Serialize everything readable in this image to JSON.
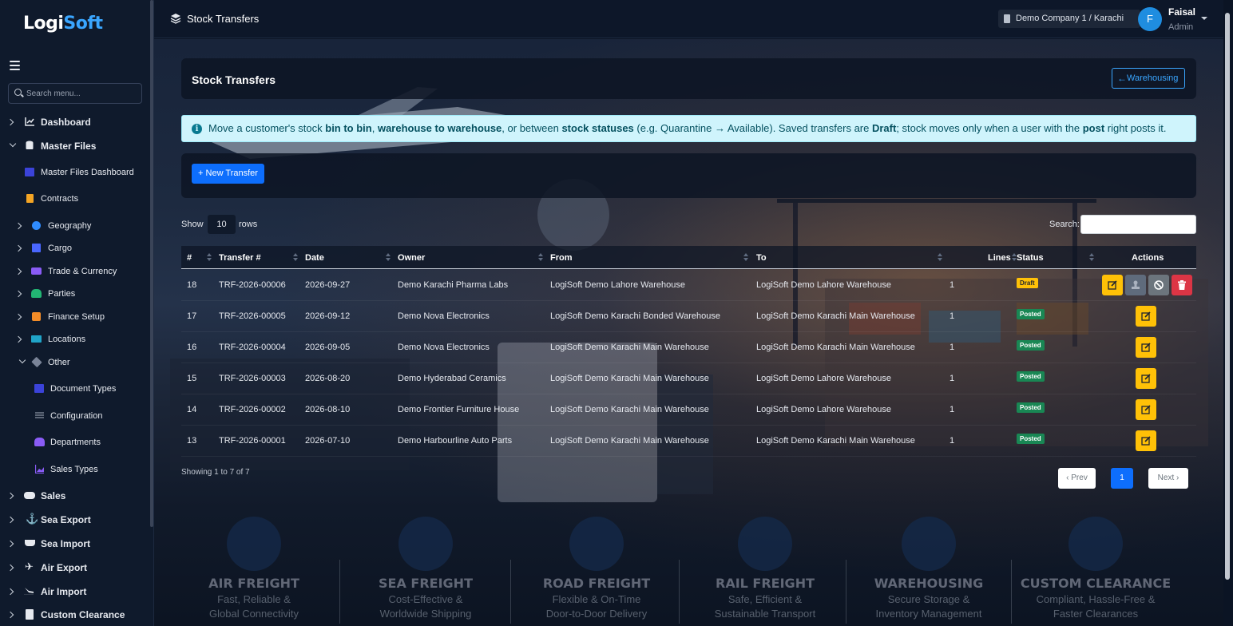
{
  "app": {
    "logo_part1": "Logi",
    "logo_part2": "Soft"
  },
  "sidebar": {
    "search_placeholder": "Search menu...",
    "items": [
      {
        "label": "Dashboard"
      },
      {
        "label": "Master Files"
      },
      {
        "label": "Master Files Dashboard"
      },
      {
        "label": "Contracts"
      },
      {
        "label": "Geography"
      },
      {
        "label": "Cargo"
      },
      {
        "label": "Trade & Currency"
      },
      {
        "label": "Parties"
      },
      {
        "label": "Finance Setup"
      },
      {
        "label": "Locations"
      },
      {
        "label": "Other"
      },
      {
        "label": "Document Types"
      },
      {
        "label": "Configuration"
      },
      {
        "label": "Departments"
      },
      {
        "label": "Sales Types"
      },
      {
        "label": "Sales"
      },
      {
        "label": "Sea Export"
      },
      {
        "label": "Sea Import"
      },
      {
        "label": "Air Export"
      },
      {
        "label": "Air Import"
      },
      {
        "label": "Custom Clearance"
      }
    ]
  },
  "header": {
    "title": "Stock Transfers",
    "company": "Demo Company 1 / Karachi",
    "user_initial": "F",
    "user_name": "Faisal",
    "user_role": "Admin"
  },
  "page": {
    "title": "Stock Transfers",
    "back_button": "Warehousing",
    "info": {
      "t1": "Move a customer's stock ",
      "b1": "bin to bin",
      "t2": ", ",
      "b2": "warehouse to warehouse",
      "t3": ", or between ",
      "b3": "stock statuses",
      "t4": " (e.g. Quarantine → Available). Saved transfers are ",
      "b4": "Draft",
      "t5": "; stock moves only when a user with the ",
      "b5": "post",
      "t6": " right posts it."
    },
    "new_button": "+ New Transfer"
  },
  "table": {
    "show_label": "Show",
    "rows_value": "10",
    "rows_label": "rows",
    "search_label": "Search:",
    "columns": [
      "#",
      "Transfer #",
      "Date",
      "Owner",
      "From",
      "To",
      "Lines",
      "Status",
      "Actions"
    ],
    "rows": [
      {
        "num": "18",
        "transfer": "TRF-2026-00006",
        "date": "2026-09-27",
        "owner": "Demo Karachi Pharma Labs",
        "from": "LogiSoft Demo Lahore Warehouse",
        "to": "LogiSoft Demo Lahore Warehouse",
        "lines": "1",
        "status": "Draft"
      },
      {
        "num": "17",
        "transfer": "TRF-2026-00005",
        "date": "2026-09-12",
        "owner": "Demo Nova Electronics",
        "from": "LogiSoft Demo Karachi Bonded Warehouse",
        "to": "LogiSoft Demo Karachi Main Warehouse",
        "lines": "1",
        "status": "Posted"
      },
      {
        "num": "16",
        "transfer": "TRF-2026-00004",
        "date": "2026-09-05",
        "owner": "Demo Nova Electronics",
        "from": "LogiSoft Demo Karachi Main Warehouse",
        "to": "LogiSoft Demo Karachi Main Warehouse",
        "lines": "1",
        "status": "Posted"
      },
      {
        "num": "15",
        "transfer": "TRF-2026-00003",
        "date": "2026-08-20",
        "owner": "Demo Hyderabad Ceramics",
        "from": "LogiSoft Demo Karachi Main Warehouse",
        "to": "LogiSoft Demo Lahore Warehouse",
        "lines": "1",
        "status": "Posted"
      },
      {
        "num": "14",
        "transfer": "TRF-2026-00002",
        "date": "2026-08-10",
        "owner": "Demo Frontier Furniture House",
        "from": "LogiSoft Demo Karachi Main Warehouse",
        "to": "LogiSoft Demo Lahore Warehouse",
        "lines": "1",
        "status": "Posted"
      },
      {
        "num": "13",
        "transfer": "TRF-2026-00001",
        "date": "2026-07-10",
        "owner": "Demo Harbourline Auto Parts",
        "from": "LogiSoft Demo Karachi Main Warehouse",
        "to": "LogiSoft Demo Karachi Main Warehouse",
        "lines": "1",
        "status": "Posted"
      }
    ],
    "showing": "Showing 1 to 7 of 7",
    "prev": "‹ Prev",
    "page": "1",
    "next": "Next ›"
  },
  "services": [
    {
      "title": "AIR FREIGHT",
      "line1": "Fast, Reliable &",
      "line2": "Global Connectivity"
    },
    {
      "title": "SEA FREIGHT",
      "line1": "Cost-Effective &",
      "line2": "Worldwide Shipping"
    },
    {
      "title": "ROAD FREIGHT",
      "line1": "Flexible & On-Time",
      "line2": "Door-to-Door Delivery"
    },
    {
      "title": "RAIL FREIGHT",
      "line1": "Safe, Efficient &",
      "line2": "Sustainable Transport"
    },
    {
      "title": "WAREHOUSING",
      "line1": "Secure Storage &",
      "line2": "Inventory Management"
    },
    {
      "title": "CUSTOM CLEARANCE",
      "line1": "Compliant, Hassle-Free &",
      "line2": "Faster Clearances"
    }
  ],
  "colors": {
    "primary": "#0d6efd",
    "warning": "#ffc107",
    "success": "#198754",
    "danger": "#dc3545",
    "info_bg": "#cff4fc",
    "sidebar_bg": "#0f1a2c"
  }
}
